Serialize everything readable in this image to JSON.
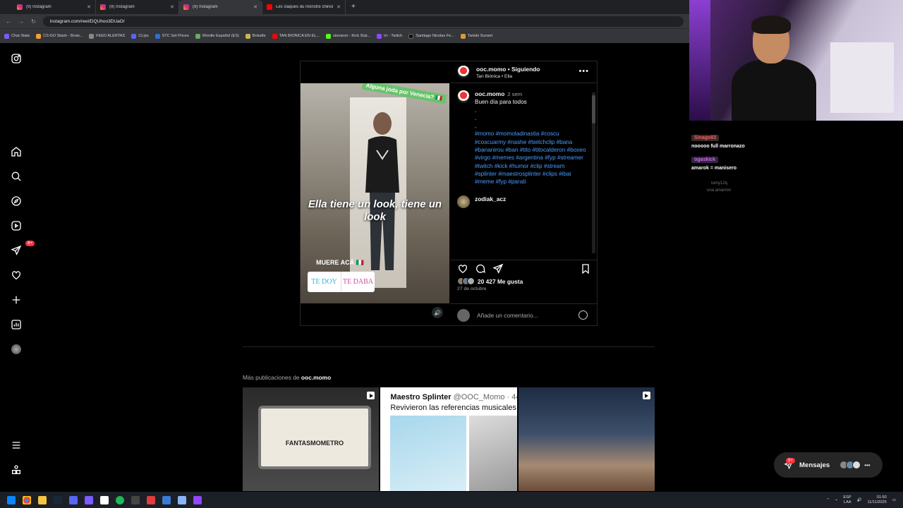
{
  "browser": {
    "tabs": [
      {
        "label": "(9) Instagram",
        "active": false
      },
      {
        "label": "(9) Instagram",
        "active": false
      },
      {
        "label": "(9) Instagram",
        "active": true
      },
      {
        "label": "Les claques du monstre chinoi...",
        "active": false
      }
    ],
    "url": "instagram.com/reel/DQUhoo3DUaO/",
    "bookmarks": [
      "Chat Stats",
      "CS:GO Stash - Brow...",
      "FEED ALERTAS",
      "CLips",
      "STC Set Prices",
      "Wordle Español (ES)",
      "Boludle",
      "TAN BIONICA EN EL...",
      "sionaron - Kick Stat...",
      "trr - Twitch",
      "Santiago Nicolas Fe...",
      "Tarluki Sunset"
    ]
  },
  "nav": {
    "notifications_badge": "9+"
  },
  "post": {
    "author": "ooc.momo",
    "follow_status": "Siguiendo",
    "audio": "Tan Biónica • Ella",
    "media": {
      "sticker": "Alguna joda por Venecia? 🇮🇹",
      "caption": "Ella tiene un look, tiene un look",
      "sub_caption": "MUERE ACÁ 🇮🇹",
      "poll_options": [
        "TE DOY",
        "TE DABA"
      ]
    },
    "comments": [
      {
        "user": "ooc.momo",
        "time": "2 sem",
        "text": "Buen día para todos",
        "dots": [
          ".",
          ".",
          "."
        ],
        "hashtags": "#momo #momoladinastia #coscu #coscuarmy #nashe #twitchclip #bana #bananirou #ban #tito #titocalderon #boxeo #virgo #memes #argentina #fyp #streamer #twitch #kick #humor #clip #stream #splinter #maestrosplinter #clips #ibai #meme #fyp #parati"
      },
      {
        "user": "zodiak_acz",
        "time": "",
        "text": ""
      }
    ],
    "likes": "20 427 Me gusta",
    "date": "27 de octubre",
    "add_comment_placeholder": "Añade un comentario..."
  },
  "more_posts": {
    "prefix": "Más publicaciones de",
    "user": "ooc.momo",
    "thumbs": [
      {
        "label": "FANTASMOMETRO"
      },
      {
        "author_name": "Maestro Splinter",
        "handle": "@OOC_Momo · 44",
        "text": "Revivieron las referencias musicales"
      },
      {
        "label": ""
      }
    ]
  },
  "messages": {
    "label": "Mensajes",
    "badge": "9+"
  },
  "stream_chat": [
    {
      "user": "Sinago83",
      "text": "nooooo full marronazo"
    },
    {
      "user": "ogaskick",
      "text": "amarok = manisero"
    },
    {
      "user": "tomy12q",
      "text": "una amarron"
    }
  ],
  "taskbar": {
    "lang_top": "ESP",
    "lang_bottom": "LAA",
    "time": "01:50",
    "date": "11/11/2025"
  }
}
